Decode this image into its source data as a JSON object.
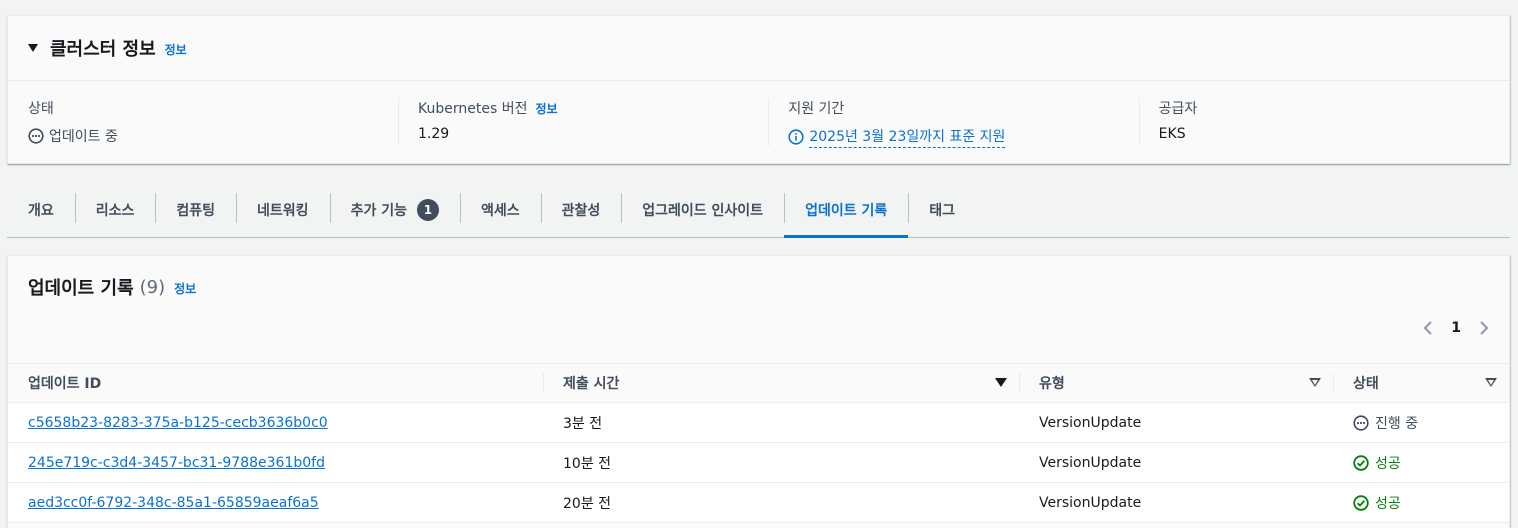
{
  "cluster_info": {
    "title": "클러스터 정보",
    "info_link": "정보",
    "fields": {
      "status": {
        "label": "상태",
        "value": "업데이트 중",
        "icon": "in-progress-icon"
      },
      "k8s_version": {
        "label": "Kubernetes 버전",
        "info_link": "정보",
        "value": "1.29"
      },
      "support": {
        "label": "지원 기간",
        "value": "2025년 3월 23일까지 표준 지원",
        "icon": "info-icon"
      },
      "provider": {
        "label": "공급자",
        "value": "EKS"
      }
    }
  },
  "tabs": [
    {
      "label": "개요"
    },
    {
      "label": "리소스"
    },
    {
      "label": "컴퓨팅"
    },
    {
      "label": "네트워킹"
    },
    {
      "label": "추가 기능",
      "badge": "1"
    },
    {
      "label": "액세스"
    },
    {
      "label": "관찰성"
    },
    {
      "label": "업그레이드 인사이트"
    },
    {
      "label": "업데이트 기록",
      "active": true
    },
    {
      "label": "태그"
    }
  ],
  "history": {
    "title": "업데이트 기록",
    "count": "(9)",
    "info_link": "정보",
    "pagination": {
      "current_page": "1"
    },
    "columns": [
      "업데이트 ID",
      "제출 시간",
      "유형",
      "상태"
    ],
    "rows": [
      {
        "id": "c5658b23-8283-375a-b125-cecb3636b0c0",
        "submitted": "3분 전",
        "type": "VersionUpdate",
        "status": "진행 중",
        "status_kind": "in-progress"
      },
      {
        "id": "245e719c-c3d4-3457-bc31-9788e361b0fd",
        "submitted": "10분 전",
        "type": "VersionUpdate",
        "status": "성공",
        "status_kind": "success"
      },
      {
        "id": "aed3cc0f-6792-348c-85a1-65859aeaf6a5",
        "submitted": "20분 전",
        "type": "VersionUpdate",
        "status": "성공",
        "status_kind": "success"
      }
    ]
  },
  "colors": {
    "link": "#0972d3",
    "success": "#037f0c",
    "text": "#16191f",
    "muted": "#414d5c"
  }
}
